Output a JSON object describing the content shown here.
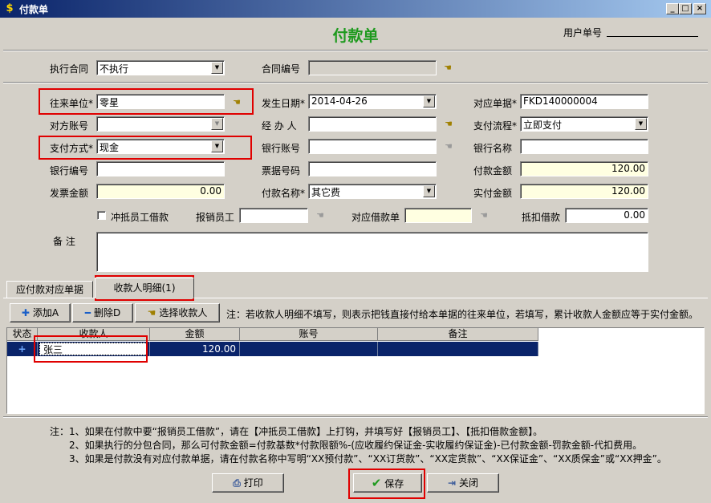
{
  "window": {
    "title": "付款单"
  },
  "form": {
    "title": "付款单",
    "user_no_label": "用户单号"
  },
  "contract": {
    "exec_label": "执行合同",
    "exec_value": "不执行",
    "no_label": "合同编号",
    "no_value": ""
  },
  "fields": {
    "partner_label": "往来单位*",
    "partner_value": "零星",
    "date_label": "发生日期*",
    "date_value": "2014-04-26",
    "doc_label": "对应单据*",
    "doc_value": "FKD140000004",
    "account_label": "对方账号",
    "account_value": "",
    "handler_label": "经 办 人",
    "handler_value": "",
    "flow_label": "支付流程*",
    "flow_value": "立即支付",
    "paymethod_label": "支付方式*",
    "paymethod_value": "现金",
    "bankacct_label": "银行账号",
    "bankacct_value": "",
    "bankname_label": "银行名称",
    "bankname_value": "",
    "bankno_label": "银行编号",
    "bankno_value": "",
    "ticket_label": "票据号码",
    "ticket_value": "",
    "payamt_label": "付款金额",
    "payamt_value": "120.00",
    "invoice_label": "发票金额",
    "invoice_value": "0.00",
    "payname_label": "付款名称*",
    "payname_value": "其它费",
    "actual_label": "实付金额",
    "actual_value": "120.00",
    "offset_label": "冲抵员工借款",
    "employee_label": "报销员工",
    "employee_value": "",
    "loan_label": "对应借款单",
    "loan_value": "",
    "deduct_label": "抵扣借款",
    "deduct_value": "0.00",
    "remark_label": "备    注",
    "remark_value": ""
  },
  "tabs": [
    {
      "label": "应付款对应单据"
    },
    {
      "label": "收款人明细(1)"
    }
  ],
  "toolbar": {
    "add_label": "添加A",
    "delete_label": "删除D",
    "select_label": "选择收款人",
    "note": "注：若收款人明细不填写，则表示把钱直接付给本单据的往来单位，若填写，累计收款人金额应等于实付金额。"
  },
  "grid": {
    "columns": [
      "状态",
      "收款人",
      "金额",
      "账号",
      "备注"
    ],
    "rows": [
      {
        "status": "+",
        "payee": "张三",
        "amount": "120.00",
        "account": "",
        "remark": ""
      }
    ]
  },
  "notes": [
    "注：1、如果在付款中要“报销员工借款”，请在【冲抵员工借款】上打钩，并填写好【报销员工】、【抵扣借款金额】。",
    "2、如果执行的分包合同，那么可付款金额=付款基数*付款限额%-(应收履约保证金-实收履约保证金)-已付款金额-罚款金额-代扣费用。",
    "3、如果是付款没有对应付款单据，请在付款名称中写明“XX预付款”、“XX订货款”、“XX定货款”、“XX保证金”、“XX质保金”或“XX押金”。"
  ],
  "buttons": {
    "print_label": "打印",
    "save_label": "保存",
    "close_label": "关闭"
  },
  "colors": {
    "title_green": "#1e9a1e",
    "highlight_red": "#e00000",
    "selection_navy": "#0a246a"
  }
}
